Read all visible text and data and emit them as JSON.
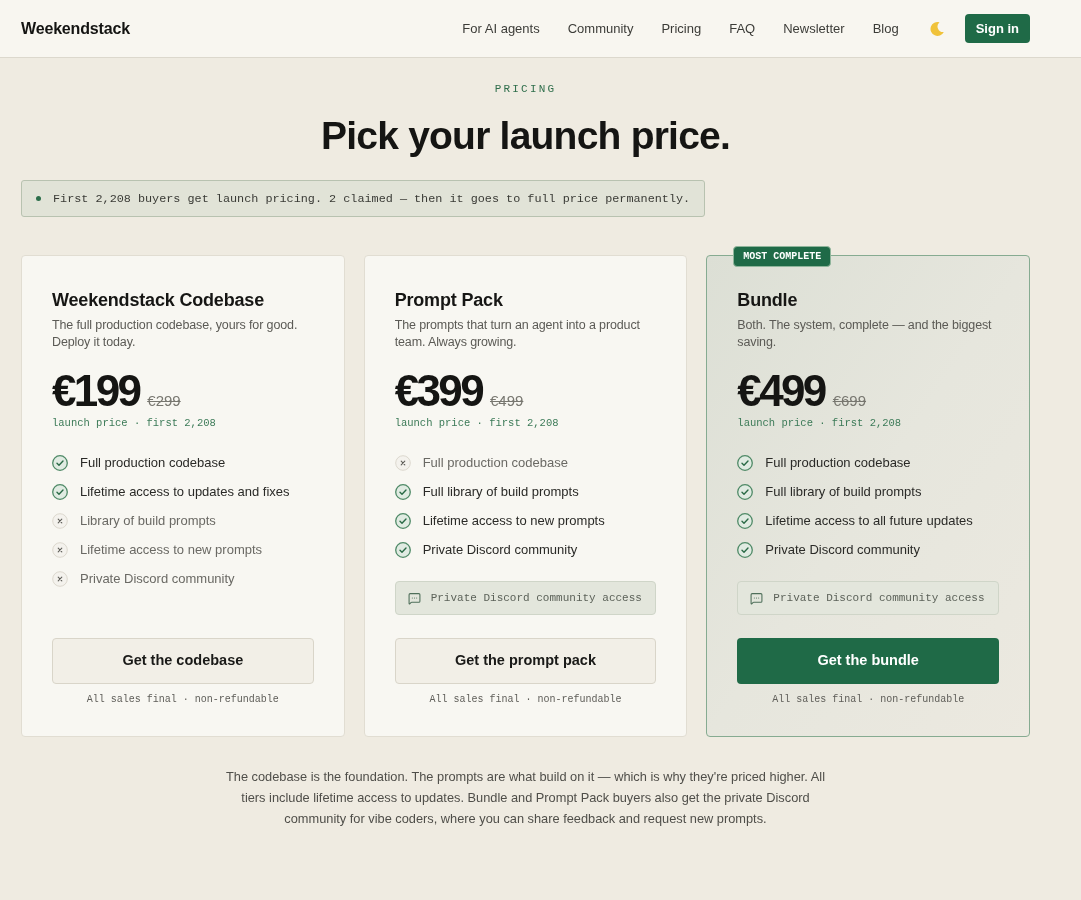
{
  "nav": {
    "logo": "Weekendstack",
    "links": [
      "For AI agents",
      "Community",
      "Pricing",
      "FAQ",
      "Newsletter",
      "Blog"
    ],
    "sign_in": "Sign in"
  },
  "hero": {
    "eyebrow": "PRICING",
    "title": "Pick your launch price.",
    "notice": "First 2,208 buyers get launch pricing. 2 claimed — then it goes to full price permanently."
  },
  "plans": [
    {
      "name": "Weekendstack Codebase",
      "description": "The full production codebase, yours for good. Deploy it today.",
      "price": "€199",
      "old_price": "€299",
      "price_note": "launch price · first 2,208",
      "featured": false,
      "features": [
        {
          "label": "Full production codebase",
          "included": true
        },
        {
          "label": "Lifetime access to updates and fixes",
          "included": true
        },
        {
          "label": "Library of build prompts",
          "included": false
        },
        {
          "label": "Lifetime access to new prompts",
          "included": false
        },
        {
          "label": "Private Discord community",
          "included": false
        }
      ],
      "cta": "Get the codebase",
      "fine_print": "All sales final · non-refundable"
    },
    {
      "name": "Prompt Pack",
      "description": "The prompts that turn an agent into a product team. Always growing.",
      "price": "€399",
      "old_price": "€499",
      "price_note": "launch price · first 2,208",
      "featured": false,
      "features": [
        {
          "label": "Full production codebase",
          "included": false
        },
        {
          "label": "Full library of build prompts",
          "included": true
        },
        {
          "label": "Lifetime access to new prompts",
          "included": true
        },
        {
          "label": "Private Discord community",
          "included": true
        }
      ],
      "note": "Private Discord community access",
      "cta": "Get the prompt pack",
      "fine_print": "All sales final · non-refundable"
    },
    {
      "name": "Bundle",
      "badge": "MOST COMPLETE",
      "description": "Both. The system, complete — and the biggest saving.",
      "price": "€499",
      "old_price": "€699",
      "price_note": "launch price · first 2,208",
      "featured": true,
      "features": [
        {
          "label": "Full production codebase",
          "included": true
        },
        {
          "label": "Full library of build prompts",
          "included": true
        },
        {
          "label": "Lifetime access to all future updates",
          "included": true
        },
        {
          "label": "Private Discord community",
          "included": true
        }
      ],
      "note": "Private Discord community access",
      "cta": "Get the bundle",
      "fine_print": "All sales final · non-refundable"
    }
  ],
  "footnote": "The codebase is the foundation. The prompts are what build on it — which is why they're priced higher. All tiers include lifetime access to updates. Bundle and Prompt Pack buyers also get the private Discord community for vibe coders, where you can share feedback and request new prompts."
}
